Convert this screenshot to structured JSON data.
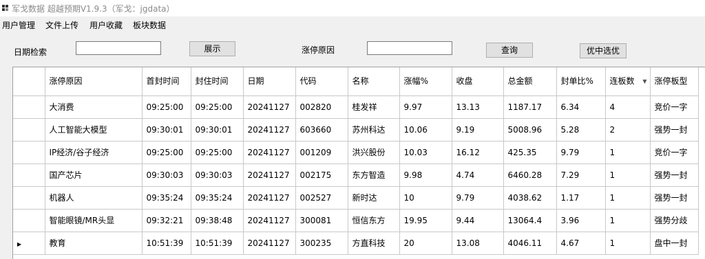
{
  "window": {
    "title": "军戈数据 超越预期V1.9.3（军戈：jgdata）"
  },
  "menu": [
    "用户管理",
    "文件上传",
    "用户收藏",
    "板块数据"
  ],
  "search": {
    "date_label": "日期检索",
    "date_value": "",
    "show_button": "展示",
    "reason_label": "涨停原因",
    "reason_value": "",
    "query_button": "查询",
    "best_button": "优中选优"
  },
  "table": {
    "headers": [
      "涨停原因",
      "首封时间",
      "封住时间",
      "日期",
      "代码",
      "名称",
      "涨幅%",
      "收盘",
      "总金额",
      "封单比%",
      "连板数",
      "涨停板型"
    ],
    "rows": [
      [
        "大消费",
        "09:25:00",
        "09:25:00",
        "20241127",
        "002820",
        "桂发祥",
        "9.97",
        "13.13",
        "1187.17",
        "6.34",
        "4",
        "竞价一字"
      ],
      [
        "人工智能大模型",
        "09:30:01",
        "09:30:01",
        "20241127",
        "603660",
        "苏州科达",
        "10.06",
        "9.19",
        "5008.96",
        "5.28",
        "2",
        "强势一封"
      ],
      [
        "IP经济/谷子经济",
        "09:25:00",
        "09:25:00",
        "20241127",
        "001209",
        "洪兴股份",
        "10.03",
        "16.12",
        "425.35",
        "9.79",
        "1",
        "竞价一字"
      ],
      [
        "国产芯片",
        "09:30:03",
        "09:30:03",
        "20241127",
        "002175",
        "东方智造",
        "9.98",
        "4.74",
        "6460.28",
        "7.29",
        "1",
        "强势一封"
      ],
      [
        "机器人",
        "09:35:24",
        "09:35:24",
        "20241127",
        "002527",
        "新时达",
        "10",
        "9.79",
        "4038.62",
        "1.17",
        "1",
        "强势一封"
      ],
      [
        "智能眼镜/MR头显",
        "09:32:21",
        "09:38:48",
        "20241127",
        "300081",
        "恒信东方",
        "19.95",
        "9.44",
        "13064.4",
        "3.96",
        "1",
        "强势分歧"
      ],
      [
        "教育",
        "10:51:39",
        "10:51:39",
        "20241127",
        "300235",
        "方直科技",
        "20",
        "13.08",
        "4046.11",
        "4.67",
        "1",
        "盘中一封"
      ]
    ],
    "current_row": 6
  },
  "icons": {
    "app": "app-grid-icon",
    "sort": "sort-down-icon",
    "row_pointer": "current-row-pointer-icon"
  }
}
